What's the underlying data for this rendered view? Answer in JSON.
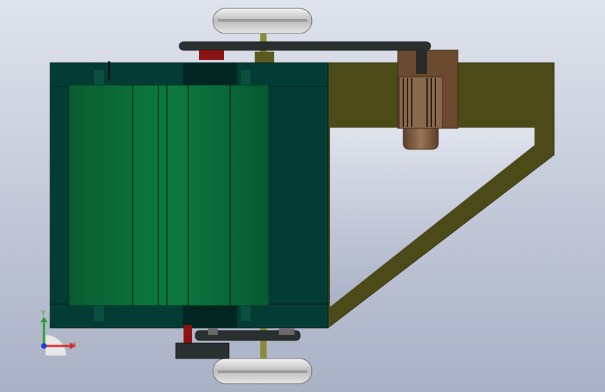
{
  "triad": {
    "y_label": "Y",
    "x_label": "X",
    "y_color": "#2aa02a",
    "x_color": "#d42a2a",
    "z_color": "#1f3fd0"
  },
  "colors": {
    "background_top": "#dfe3ec",
    "background_bottom": "#aab2c6",
    "frame_dark_teal": "#023c35",
    "drum_green": "#0a6a3a",
    "arm_olive": "#4b4a18",
    "motor_housing": "#7a5a3e",
    "pulley_red": "#8b1212",
    "wheel_grey": "#c8c8c8",
    "belt_dark": "#2a3030"
  }
}
